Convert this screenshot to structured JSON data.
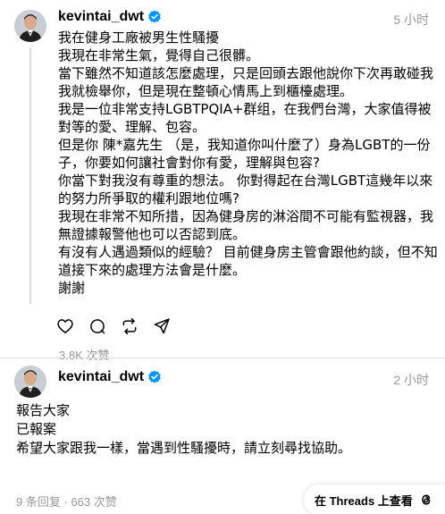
{
  "posts": [
    {
      "username": "kevintai_dwt",
      "time": "5 小时",
      "lines": [
        "我在健身工廠被男生性騷擾",
        "我現在非常生氣，覺得自己很髒。",
        "當下雖然不知道該怎麼處理，只是回頭去跟他說你下次再敢碰我我就檢舉你，但是現在整頓心情馬上到櫃檯處理。",
        "我是一位非常支持LGBTPQIA+群组，在我們台灣，大家值得被對等的愛、理解、包容。",
        "但是你 陳*嘉先生 （是，我知道你叫什麼了）身為LGBT的一份子，你要如何讓社會對你有愛，理解與包容?",
        "你當下對我沒有尊重的想法。 你對得起在台灣LGBT這幾年以來的努力所爭取的權利跟地位嗎?",
        "我現在非常不知所措，因為健身房的淋浴間不可能有監視器，我無證據報警他也可以否認到底。",
        "有沒有人遇過類似的經驗？ 目前健身房主管會跟他約談，但不知道接下來的處理方法會是什麼。",
        "謝謝"
      ],
      "views": "3.8K 次赞"
    },
    {
      "username": "kevintai_dwt",
      "time": "2 小时",
      "lines": [
        "報告大家",
        "已報案",
        "希望大家跟我一樣，當遇到性騷擾時，請立刻尋找協助。"
      ],
      "stats": "9 条回复 · 663 次赞"
    }
  ],
  "open_in_threads": "在 Threads 上查看",
  "icons": {
    "verified": "verified-badge-icon",
    "like": "heart-icon",
    "reply": "reply-bubble-icon",
    "repost": "repost-icon",
    "share": "share-icon",
    "threads": "threads-logo-icon"
  },
  "colors": {
    "verified": "#0095f6",
    "muted": "#999999",
    "divider": "#dbdbdb"
  }
}
